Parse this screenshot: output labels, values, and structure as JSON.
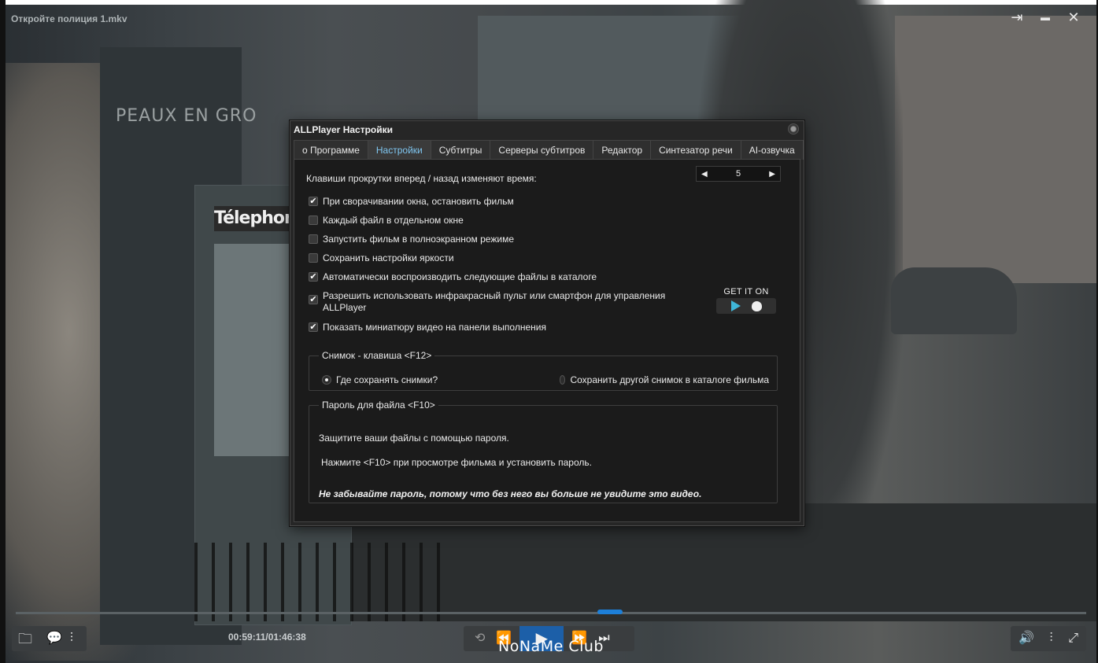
{
  "window": {
    "file_title": "Откройте полиция 1.mkv",
    "pin_icon": "⇥",
    "minimize_icon": "▬",
    "close_icon": "✕"
  },
  "scene": {
    "sign_text": "PEAUX EN GRO",
    "telephone_text": "Télephone"
  },
  "dialog": {
    "title": "ALLPlayer Настройки",
    "tabs": [
      {
        "label": "о Программе"
      },
      {
        "label": "Настройки"
      },
      {
        "label": "Субтитры"
      },
      {
        "label": "Серверы субтитров"
      },
      {
        "label": "Редактор"
      },
      {
        "label": "Синтезатор речи"
      },
      {
        "label": "AI-озвучка"
      }
    ],
    "active_tab": "Настройки",
    "scroll_label": "Клавиши прокрутки вперед / назад изменяют время:",
    "scroll_value": "5",
    "stepper_left": "◀",
    "stepper_right": "▶",
    "checkboxes": [
      {
        "label": "При сворачивании окна, остановить фильм",
        "checked": true,
        "mark": "✔"
      },
      {
        "label": "Каждый файл в отдельном окне",
        "checked": false,
        "mark": ""
      },
      {
        "label": "Запустить фильм в полноэкранном режиме",
        "checked": false,
        "mark": ""
      },
      {
        "label": "Сохранить настройки яркости",
        "checked": false,
        "mark": ""
      },
      {
        "label": "Автоматически воспроизводить следующие файлы в каталоге",
        "checked": true,
        "mark": "✔"
      },
      {
        "label": "Разрешить использовать инфракрасный пульт или смартфон для управления",
        "label2": "ALLPlayer",
        "checked": true,
        "mark": "✔"
      },
      {
        "label": "Показать миниатюру видео на панели выполнения",
        "checked": true,
        "mark": "✔"
      }
    ],
    "store_badge": "GET IT ON",
    "snapshot": {
      "legend": "Снимок - клавиша <F12>",
      "option1": "Где сохранять снимки?",
      "option2": "Сохранить другой снимок в каталоге фильма",
      "selected": 1
    },
    "password": {
      "legend": "Пароль для файла <F10>",
      "line1": "Защитите ваши файлы с помощью пароля.",
      "line2": "Нажмите <F10> при просмотре фильма и установить пароль.",
      "line3": "Не забывайте пароль, потому что без него вы больше не увидите это видео."
    }
  },
  "player": {
    "timecode": "00:59:11/01:46:38",
    "progress_fraction": 0.555,
    "icons": {
      "folder": "🗀",
      "subtitles": "💬",
      "equalizer": "⫶",
      "repeat": "⟲",
      "rewind": "⏪",
      "play": "▶",
      "forward": "⏩",
      "next": "⏭",
      "volume": "🔊",
      "settings": "⫶",
      "fullscreen": "⤢"
    }
  },
  "watermark": "NoNaMe Club"
}
